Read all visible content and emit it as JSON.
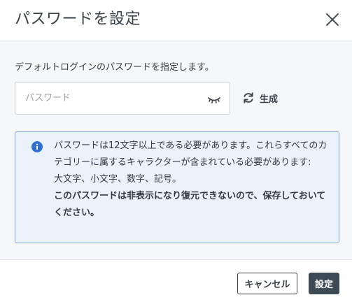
{
  "dialog": {
    "title": "パスワードを設定",
    "close_icon": "close-icon"
  },
  "form": {
    "description": "デフォルトログインのパスワードを指定します。",
    "password_placeholder": "パスワード",
    "password_value": "",
    "visibility_icon": "eye-closed-icon",
    "generate_icon": "refresh-icon",
    "generate_label": "生成"
  },
  "info": {
    "icon": "info-icon",
    "line1": "パスワードは12文字以上である必要があります。これらすべてのカテゴリーに属するキャラクターが含まれている必要があります:",
    "line2": "大文字、小文字、数字、記号。",
    "line3": "このパスワードは非表示になり復元できないので、保存しておいてください。"
  },
  "footer": {
    "cancel_label": "キャンセル",
    "save_label": "設定"
  },
  "colors": {
    "primary_button": "#3d4a56",
    "info_background": "#eaf2fb",
    "info_border": "#7ea7d8",
    "info_icon": "#2f6fd1",
    "body_background": "#f5f7f9"
  }
}
